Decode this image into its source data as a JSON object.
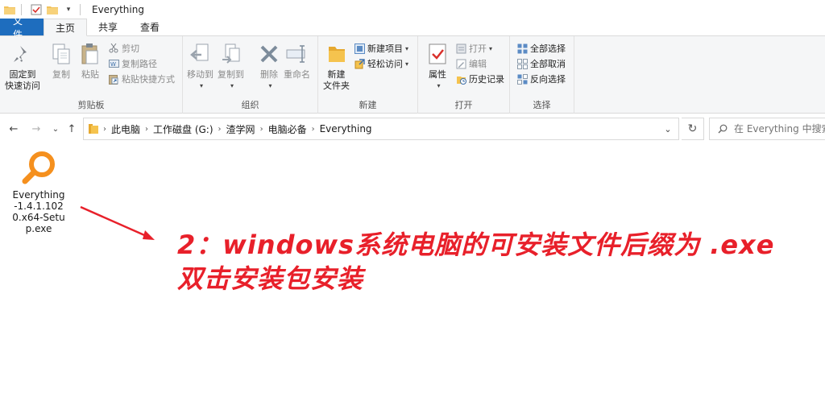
{
  "window": {
    "title": "Everything"
  },
  "tabs": [
    {
      "label": "文件"
    },
    {
      "label": "主页"
    },
    {
      "label": "共享"
    },
    {
      "label": "查看"
    }
  ],
  "ribbon": {
    "clipboard": {
      "label": "剪贴板",
      "pin": "固定到\n快速访问",
      "pin_l1": "固定到",
      "pin_l2": "快速访问",
      "copy": "复制",
      "paste": "粘贴",
      "cut": "剪切",
      "copy_path": "复制路径",
      "paste_shortcut": "粘贴快捷方式"
    },
    "organize": {
      "label": "组织",
      "move_to": "移动到",
      "copy_to": "复制到",
      "delete": "删除",
      "rename": "重命名"
    },
    "new": {
      "label": "新建",
      "new_folder_l1": "新建",
      "new_folder_l2": "文件夹",
      "new_item": "新建项目",
      "easy_access": "轻松访问"
    },
    "open": {
      "label": "打开",
      "properties": "属性",
      "open": "打开",
      "edit": "编辑",
      "history": "历史记录"
    },
    "select": {
      "label": "选择",
      "select_all": "全部选择",
      "select_none": "全部取消",
      "invert": "反向选择"
    }
  },
  "address": {
    "crumbs": [
      "此电脑",
      "工作磁盘 (G:)",
      "渣学网",
      "电脑必备",
      "Everything"
    ]
  },
  "search": {
    "placeholder": "在 Everything 中搜索"
  },
  "files": [
    {
      "name": "Everything-1.4.1.1020.x64-Setup.exe",
      "line1": "Everything",
      "line2": "-1.4.1.102",
      "line3": "0.x64-Setu",
      "line4": "p.exe"
    }
  ],
  "annotation": {
    "line1": "2：windows系统电脑的可安装文件后缀为 .exe",
    "line2": "双击安装包安装",
    "color": "#e8202a"
  },
  "colors": {
    "file_tab": "#1e6dbe",
    "ribbon_bg": "#f5f6f7",
    "icon_orange": "#f5901e"
  }
}
